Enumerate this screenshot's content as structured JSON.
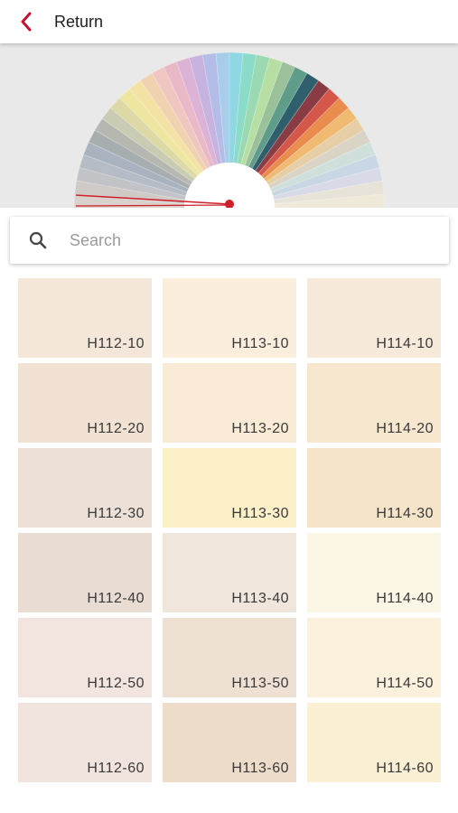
{
  "header": {
    "back_label": "Return"
  },
  "fan": {
    "colors": [
      "#d9d2cc",
      "#cfcac6",
      "#c2c3c6",
      "#b6bcc5",
      "#a9b3c0",
      "#a8aeb0",
      "#b6b7b0",
      "#c9cbb2",
      "#dcd9a6",
      "#eee6a0",
      "#f3e2a3",
      "#f0d2b0",
      "#efc7c0",
      "#eab9c7",
      "#dcb3d6",
      "#c7b2e0",
      "#b3bde8",
      "#a7cdea",
      "#8fd7e2",
      "#8adcc9",
      "#9ad9b1",
      "#b8dfa3",
      "#9bc19a",
      "#5f9c8a",
      "#2f5f6c",
      "#8a3c44",
      "#d4574a",
      "#e98c4d",
      "#f0ba73",
      "#e6cfa6",
      "#d9d4c6",
      "#cfe0dc",
      "#c9d6e3",
      "#d8dbe7",
      "#e7e3d8",
      "#efe9d9"
    ],
    "marker_color": "#cf1f2a"
  },
  "search": {
    "placeholder": "Search"
  },
  "swatches": [
    {
      "code": "H112-10",
      "color": "#f4e6d8"
    },
    {
      "code": "H113-10",
      "color": "#fbeedd"
    },
    {
      "code": "H114-10",
      "color": "#f7eadb"
    },
    {
      "code": "H112-20",
      "color": "#f2e2d3"
    },
    {
      "code": "H113-20",
      "color": "#f9ebd5"
    },
    {
      "code": "H114-20",
      "color": "#f7e7cf"
    },
    {
      "code": "H112-30",
      "color": "#ede1d7"
    },
    {
      "code": "H113-30",
      "color": "#fbf0c8"
    },
    {
      "code": "H114-30",
      "color": "#f5e4c8"
    },
    {
      "code": "H112-40",
      "color": "#e9ddd3"
    },
    {
      "code": "H113-40",
      "color": "#f1e6dc"
    },
    {
      "code": "H114-40",
      "color": "#fbf6e6"
    },
    {
      "code": "H112-50",
      "color": "#f2e5df"
    },
    {
      "code": "H113-50",
      "color": "#eee0d3"
    },
    {
      "code": "H114-50",
      "color": "#fbf1dd"
    },
    {
      "code": "H112-60",
      "color": "#f1e4de"
    },
    {
      "code": "H113-60",
      "color": "#eddcca"
    },
    {
      "code": "H114-60",
      "color": "#fbf0d4"
    }
  ]
}
